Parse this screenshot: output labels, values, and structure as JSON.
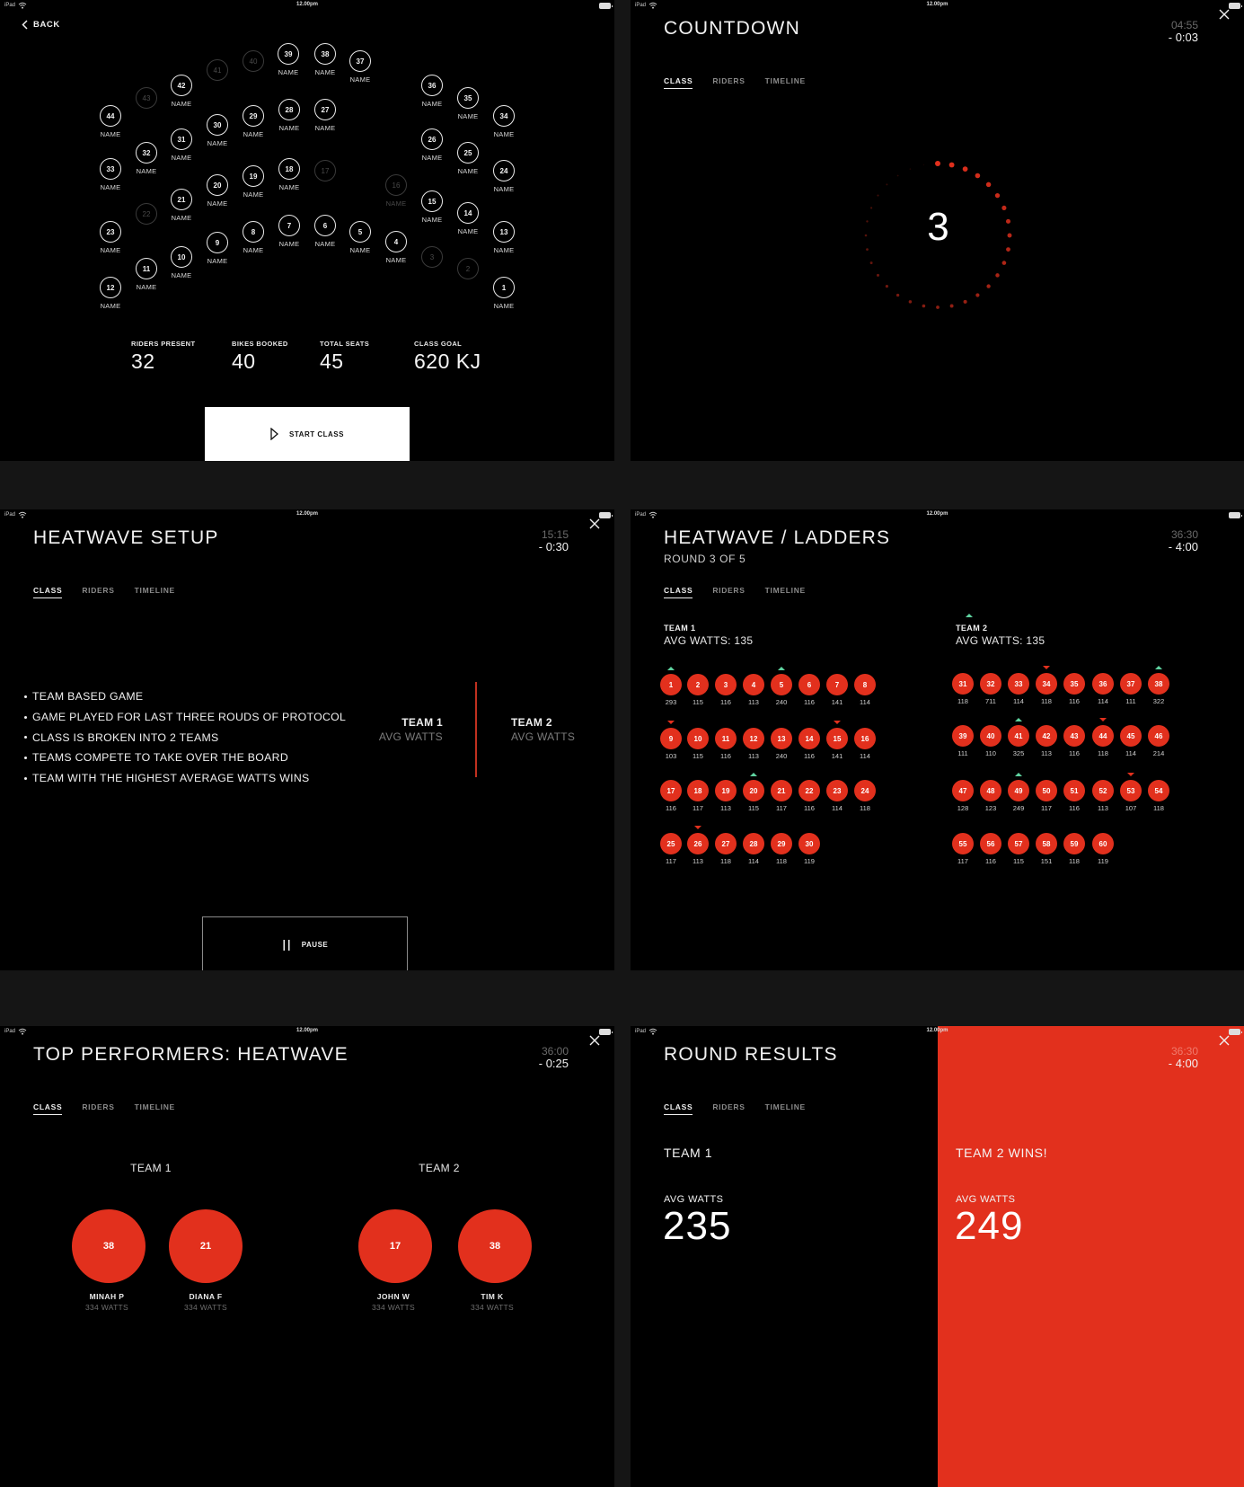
{
  "status_bar": {
    "device": "iPad",
    "time": "12.00pm"
  },
  "colors": {
    "accent": "#e2301d",
    "up": "#5fd3a0",
    "background": "#000000",
    "gutter": "#151515"
  },
  "tabs": [
    "CLASS",
    "RIDERS",
    "TIMELINE"
  ],
  "seat_map": {
    "back_label": "BACK",
    "seat_name_placeholder": "NAME",
    "seats": [
      {
        "n": "44",
        "state": "booked"
      },
      {
        "n": "33",
        "state": "booked"
      },
      {
        "n": "23",
        "state": "booked"
      },
      {
        "n": "12",
        "state": "booked"
      },
      {
        "n": "43",
        "state": "empty"
      },
      {
        "n": "32",
        "state": "booked"
      },
      {
        "n": "22",
        "state": "empty"
      },
      {
        "n": "11",
        "state": "booked"
      },
      {
        "n": "42",
        "state": "booked"
      },
      {
        "n": "31",
        "state": "booked"
      },
      {
        "n": "21",
        "state": "booked"
      },
      {
        "n": "10",
        "state": "booked"
      },
      {
        "n": "41",
        "state": "empty"
      },
      {
        "n": "30",
        "state": "booked"
      },
      {
        "n": "20",
        "state": "booked"
      },
      {
        "n": "9",
        "state": "booked"
      },
      {
        "n": "40",
        "state": "empty"
      },
      {
        "n": "29",
        "state": "booked"
      },
      {
        "n": "19",
        "state": "booked"
      },
      {
        "n": "8",
        "state": "booked"
      },
      {
        "n": "39",
        "state": "booked"
      },
      {
        "n": "28",
        "state": "booked"
      },
      {
        "n": "18",
        "state": "booked"
      },
      {
        "n": "7",
        "state": "booked"
      },
      {
        "n": "38",
        "state": "booked"
      },
      {
        "n": "27",
        "state": "booked"
      },
      {
        "n": "17",
        "state": "empty"
      },
      {
        "n": "6",
        "state": "booked"
      },
      {
        "n": "37",
        "state": "booked"
      },
      {
        "n": "5",
        "state": "booked"
      },
      {
        "n": "16",
        "state": "empty-named"
      },
      {
        "n": "4",
        "state": "booked"
      },
      {
        "n": "36",
        "state": "booked"
      },
      {
        "n": "26",
        "state": "booked"
      },
      {
        "n": "15",
        "state": "booked"
      },
      {
        "n": "3",
        "state": "empty"
      },
      {
        "n": "35",
        "state": "booked"
      },
      {
        "n": "25",
        "state": "booked"
      },
      {
        "n": "14",
        "state": "booked"
      },
      {
        "n": "2",
        "state": "empty"
      },
      {
        "n": "34",
        "state": "booked"
      },
      {
        "n": "24",
        "state": "booked"
      },
      {
        "n": "13",
        "state": "booked"
      },
      {
        "n": "1",
        "state": "booked"
      }
    ],
    "stats": [
      {
        "label": "RIDERS PRESENT",
        "value": "32"
      },
      {
        "label": "BIKES BOOKED",
        "value": "40"
      },
      {
        "label": "TOTAL SEATS",
        "value": "45"
      },
      {
        "label": "CLASS GOAL",
        "value": "620 KJ"
      }
    ],
    "start_button": "START CLASS"
  },
  "countdown": {
    "title": "COUNTDOWN",
    "timer_elapsed": "04:55",
    "timer_remaining": "- 0:03",
    "count": "3",
    "ring_total_dots": 32,
    "ring_progress": 0.5
  },
  "heatwave_setup": {
    "title": "HEATWAVE SETUP",
    "timer_elapsed": "15:15",
    "timer_remaining": "- 0:30",
    "rules": [
      "TEAM BASED GAME",
      "GAME PLAYED FOR LAST THREE ROUDS OF PROTOCOL",
      "CLASS IS BROKEN INTO 2 TEAMS",
      "TEAMS COMPETE TO TAKE OVER THE BOARD",
      "TEAM WITH THE HIGHEST AVERAGE WATTS WINS"
    ],
    "team1": {
      "name": "TEAM 1",
      "sub": "AVG WATTS"
    },
    "team2": {
      "name": "TEAM 2",
      "sub": "AVG WATTS"
    },
    "pause_button": "PAUSE"
  },
  "ladders": {
    "title": "HEATWAVE / LADDERS",
    "subtitle": "ROUND 3 OF 5",
    "timer_elapsed": "36:30",
    "timer_remaining": "- 4:00",
    "teams": [
      {
        "name": "TEAM 1",
        "avg": "AVG WATTS: 135",
        "trend": "",
        "riders": [
          {
            "n": "1",
            "w": "293",
            "t": "up"
          },
          {
            "n": "2",
            "w": "115",
            "t": ""
          },
          {
            "n": "3",
            "w": "116",
            "t": ""
          },
          {
            "n": "4",
            "w": "113",
            "t": ""
          },
          {
            "n": "5",
            "w": "240",
            "t": "up"
          },
          {
            "n": "6",
            "w": "116",
            "t": ""
          },
          {
            "n": "7",
            "w": "141",
            "t": ""
          },
          {
            "n": "8",
            "w": "114",
            "t": ""
          },
          {
            "n": "9",
            "w": "103",
            "t": "down"
          },
          {
            "n": "10",
            "w": "115",
            "t": ""
          },
          {
            "n": "11",
            "w": "116",
            "t": ""
          },
          {
            "n": "12",
            "w": "113",
            "t": ""
          },
          {
            "n": "13",
            "w": "240",
            "t": ""
          },
          {
            "n": "14",
            "w": "116",
            "t": ""
          },
          {
            "n": "15",
            "w": "141",
            "t": "down"
          },
          {
            "n": "16",
            "w": "114",
            "t": ""
          },
          {
            "n": "17",
            "w": "116",
            "t": ""
          },
          {
            "n": "18",
            "w": "117",
            "t": ""
          },
          {
            "n": "19",
            "w": "113",
            "t": ""
          },
          {
            "n": "20",
            "w": "115",
            "t": "up"
          },
          {
            "n": "21",
            "w": "117",
            "t": ""
          },
          {
            "n": "22",
            "w": "116",
            "t": ""
          },
          {
            "n": "23",
            "w": "114",
            "t": ""
          },
          {
            "n": "24",
            "w": "118",
            "t": ""
          },
          {
            "n": "25",
            "w": "117",
            "t": ""
          },
          {
            "n": "26",
            "w": "113",
            "t": "down"
          },
          {
            "n": "27",
            "w": "118",
            "t": ""
          },
          {
            "n": "28",
            "w": "114",
            "t": ""
          },
          {
            "n": "29",
            "w": "118",
            "t": ""
          },
          {
            "n": "30",
            "w": "119",
            "t": ""
          }
        ]
      },
      {
        "name": "TEAM 2",
        "avg": "AVG WATTS: 135",
        "trend": "up",
        "riders": [
          {
            "n": "31",
            "w": "118",
            "t": ""
          },
          {
            "n": "32",
            "w": "711",
            "t": ""
          },
          {
            "n": "33",
            "w": "114",
            "t": ""
          },
          {
            "n": "34",
            "w": "118",
            "t": "down"
          },
          {
            "n": "35",
            "w": "116",
            "t": ""
          },
          {
            "n": "36",
            "w": "114",
            "t": ""
          },
          {
            "n": "37",
            "w": "111",
            "t": ""
          },
          {
            "n": "38",
            "w": "322",
            "t": "up"
          },
          {
            "n": "39",
            "w": "111",
            "t": ""
          },
          {
            "n": "40",
            "w": "110",
            "t": ""
          },
          {
            "n": "41",
            "w": "325",
            "t": "up"
          },
          {
            "n": "42",
            "w": "113",
            "t": ""
          },
          {
            "n": "43",
            "w": "116",
            "t": ""
          },
          {
            "n": "44",
            "w": "118",
            "t": "down"
          },
          {
            "n": "45",
            "w": "114",
            "t": ""
          },
          {
            "n": "46",
            "w": "214",
            "t": ""
          },
          {
            "n": "47",
            "w": "128",
            "t": ""
          },
          {
            "n": "48",
            "w": "123",
            "t": ""
          },
          {
            "n": "49",
            "w": "249",
            "t": "up"
          },
          {
            "n": "50",
            "w": "117",
            "t": ""
          },
          {
            "n": "51",
            "w": "116",
            "t": ""
          },
          {
            "n": "52",
            "w": "113",
            "t": ""
          },
          {
            "n": "53",
            "w": "107",
            "t": "down"
          },
          {
            "n": "54",
            "w": "118",
            "t": ""
          },
          {
            "n": "55",
            "w": "117",
            "t": ""
          },
          {
            "n": "56",
            "w": "116",
            "t": ""
          },
          {
            "n": "57",
            "w": "115",
            "t": ""
          },
          {
            "n": "58",
            "w": "151",
            "t": ""
          },
          {
            "n": "59",
            "w": "118",
            "t": ""
          },
          {
            "n": "60",
            "w": "119",
            "t": ""
          }
        ]
      }
    ]
  },
  "top_performers": {
    "title": "TOP PERFORMERS: HEATWAVE",
    "timer_elapsed": "36:00",
    "timer_remaining": "- 0:25",
    "teams": [
      {
        "name": "TEAM 1",
        "riders": [
          {
            "seat": "38",
            "name": "MINAH P",
            "watts": "334 WATTS"
          },
          {
            "seat": "21",
            "name": "DIANA F",
            "watts": "334 WATTS"
          }
        ]
      },
      {
        "name": "TEAM 2",
        "riders": [
          {
            "seat": "17",
            "name": "JOHN W",
            "watts": "334 WATTS"
          },
          {
            "seat": "38",
            "name": "TIM K",
            "watts": "334 WATTS"
          }
        ]
      }
    ]
  },
  "round_results": {
    "title": "ROUND RESULTS",
    "timer_elapsed": "36:30",
    "timer_remaining": "- 4:00",
    "team1": {
      "label": "TEAM 1",
      "avg_label": "AVG WATTS",
      "avg": "235"
    },
    "team2": {
      "label": "TEAM 2 WINS!",
      "avg_label": "AVG WATTS",
      "avg": "249"
    }
  }
}
